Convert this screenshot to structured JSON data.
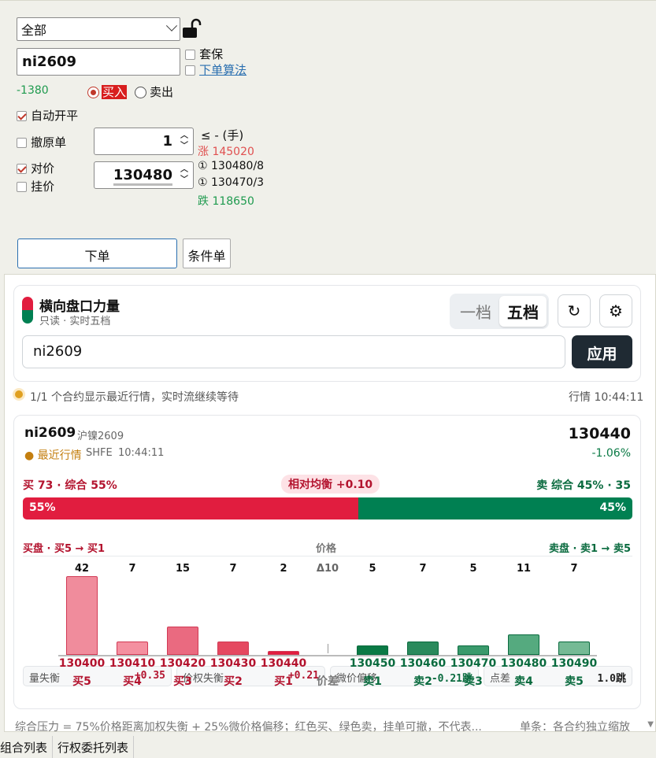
{
  "order": {
    "scope_select": "全部",
    "symbol": "ni2609",
    "hedge_label": "套保",
    "algo_link": "下单算法",
    "position_diff": "-1380",
    "buy_label": "买入",
    "sell_label": "卖出",
    "auto_openclose": "自动开平",
    "cancel_orig": "撤原单",
    "counter_price": "对价",
    "pending_price": "挂价",
    "qty": "1",
    "qty_hint": "≤ - (手)",
    "limit_up": "涨 145020",
    "price": "130480",
    "ask_ref": "① 130480/8",
    "bid_ref": "① 130470/3",
    "limit_down": "跌 118650",
    "submit_btn": "下单",
    "cond_btn": "条件单"
  },
  "widget": {
    "title": "横向盘口力量",
    "subtitle": "只读 · 实时五档",
    "seg1": "一档",
    "seg5": "五档",
    "refresh_icon": "↻",
    "gear_icon": "⚙",
    "search_value": "ni2609",
    "apply_btn": "应用",
    "status": "1/1 个合约显示最近行情，实时流继续等待",
    "status_time": "行情 10:44:11"
  },
  "contract": {
    "code": "ni2609",
    "name": "沪镍2609",
    "state": "最近行情",
    "exchange": "SHFE",
    "time": "10:44:11",
    "last": "130440",
    "change": "-1.06%",
    "buy_summary": "买 73 · 综合 55%",
    "balance": "相对均衡 +0.10",
    "sell_summary": "卖 综合 45% · 35",
    "buy_pct": 55,
    "sell_pct": 45,
    "buy_pct_label": "55%",
    "sell_pct_label": "45%",
    "metrics": [
      {
        "name": "量失衡",
        "value": "+0.35"
      },
      {
        "name": "价权失衡",
        "value": "+0.21"
      },
      {
        "name": "微价偏移",
        "value": "-0.21跳"
      },
      {
        "name": "点差",
        "value": "1.0跳"
      }
    ],
    "bid_axis": "买盘 · 买5 → 买1",
    "mid_axis": "价格",
    "ask_axis": "卖盘 · 卖1 → 卖5",
    "spread_top": "Δ10",
    "spread_bottom": "价差"
  },
  "chart_data": {
    "type": "bar",
    "categories": [
      "买5",
      "买4",
      "买3",
      "买2",
      "买1",
      "卖1",
      "卖2",
      "卖3",
      "卖4",
      "卖5"
    ],
    "prices": [
      "130400",
      "130410",
      "130420",
      "130430",
      "130440",
      "130450",
      "130460",
      "130470",
      "130480",
      "130490"
    ],
    "values": [
      42,
      7,
      15,
      7,
      2,
      5,
      7,
      5,
      11,
      7
    ]
  },
  "footer_note": "综合压力 = 75%价格距离加权失衡 + 25%微价格偏移；红色买、绿色卖，挂单可撤，不代表...",
  "footer_note2": "单条：各合约独立缩放",
  "tabs": [
    "组合列表",
    "行权委托列表"
  ],
  "colors": {
    "buy": "#e11d3f",
    "sell": "#008052",
    "buy_text": "#b3132e",
    "sell_text": "#0a6b3f"
  }
}
